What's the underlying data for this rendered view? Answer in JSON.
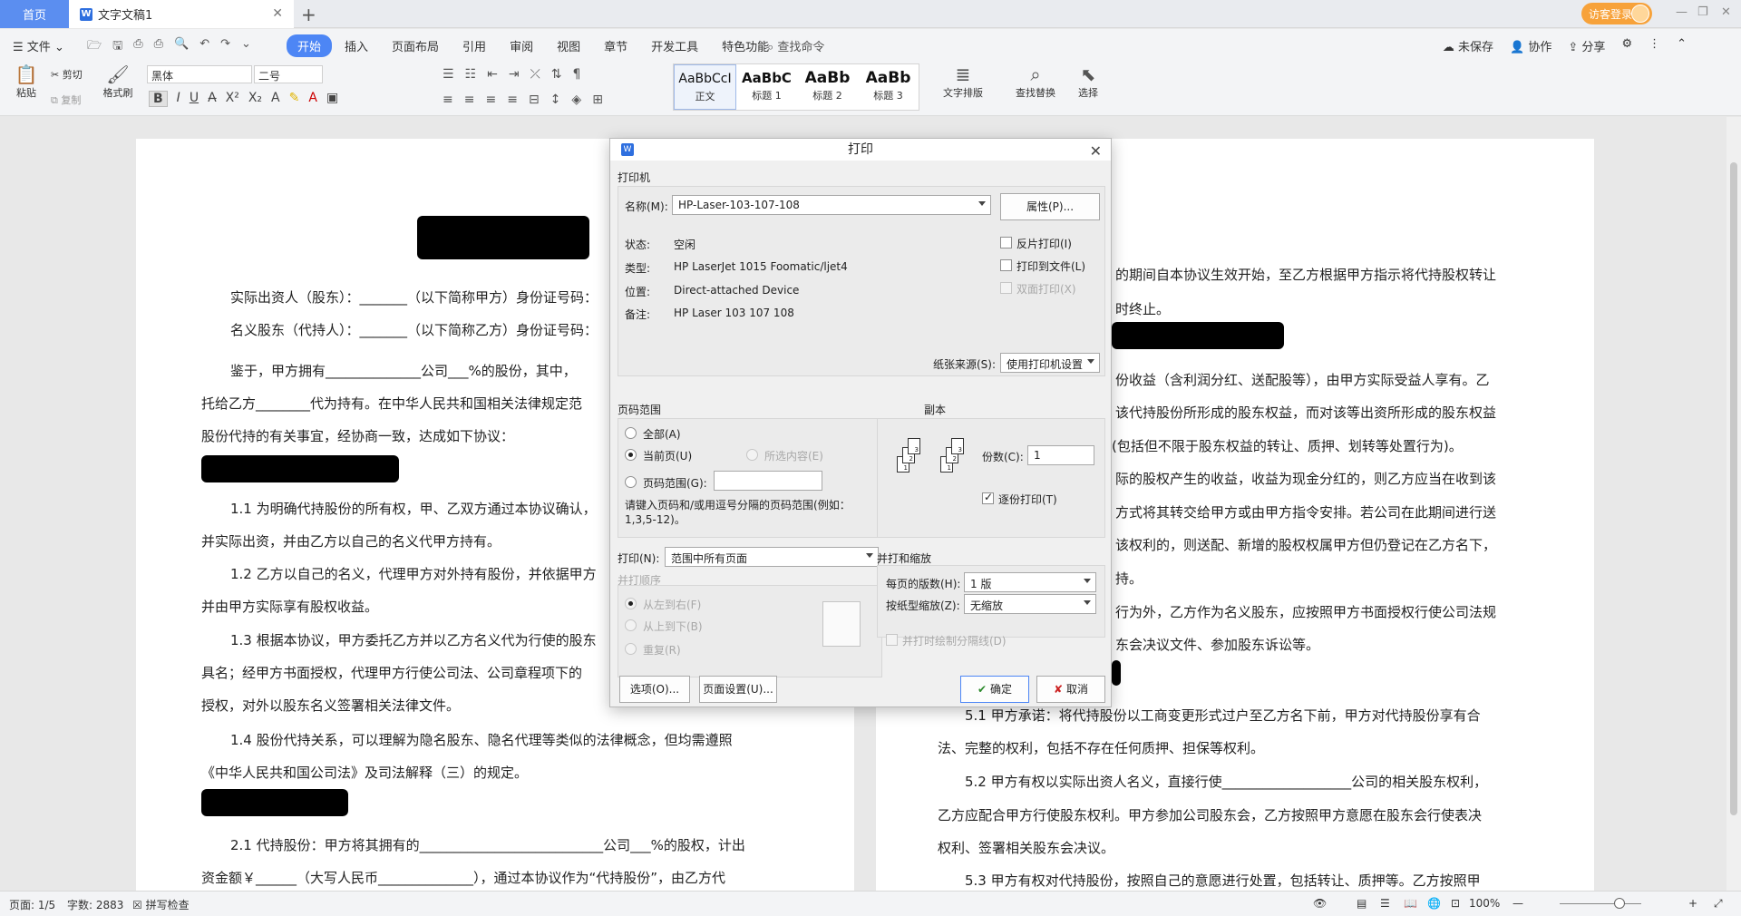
{
  "tabbar": {
    "home": "首页",
    "doc_tab": "文字文稿1",
    "doc_icon": "W",
    "guest": "访客登录"
  },
  "menubar": {
    "file": "文件",
    "items": [
      "开始",
      "插入",
      "页面布局",
      "引用",
      "审阅",
      "视图",
      "章节",
      "开发工具",
      "特色功能"
    ],
    "search": "查找命令",
    "unsaved": "未保存",
    "collab": "协作",
    "share": "分享"
  },
  "ribbon": {
    "paste": "粘贴",
    "cut": "剪切",
    "copy": "复制",
    "format_painter": "格式刷",
    "font": "黑体",
    "size": "二号",
    "styles": [
      {
        "preview": "AaBbCcI",
        "name": "正文"
      },
      {
        "preview": "AaBbC",
        "name": "标题 1"
      },
      {
        "preview": "AaBb",
        "name": "标题 2"
      },
      {
        "preview": "AaBb",
        "name": "标题 3"
      }
    ],
    "text_layout": "文字排版",
    "find_replace": "查找替换",
    "select": "选择"
  },
  "document": {
    "left_lines": [
      "实际出资人（股东）：_______（以下简称甲方）身份证号码：",
      "名义股东（代持人）：_______（以下简称乙方）身份证号码：",
      "鉴于，甲方拥有______________公司___%的股份，其中，",
      "托给乙方________代为持有。在中华人民共和国相关法律规定范",
      "股份代持的有关事宜，经协商一致，达成如下协议：",
      "1.1 为明确代持股份的所有权，甲、乙双方通过本协议确认，",
      "并实际出资，并由乙方以自己的名义代甲方持有。",
      "1.2 乙方以自己的名义，代理甲方对外持有股份，并依据甲方",
      "并由甲方实际享有股权收益。",
      "1.3 根据本协议，甲方委托乙方并以乙方名义代为行使的股东",
      "具名；经甲方书面授权，代理甲方行使公司法、公司章程项下的",
      "授权，对外以股东名义签署相关法律文件。",
      "1.4 股份代持关系，可以理解为隐名股东、隐名代理等类似的法律概念，但均需遵照",
      "《中华人民共和国公司法》及司法解释（三）的规定。",
      "2.1 代持股份：甲方将其拥有的___________________________公司___%的股权，计出",
      "资金额￥______（大写人民币______________），通过本协议作为“代持股份”，由乙方代"
    ],
    "right_lines": [
      "的期间自本协议生效开始，至乙方根据甲方指示将代持股权转让",
      "时终止。",
      "份收益（含利润分红、送配股等），由甲方实际受益人享有。乙",
      "该代持股份所形成的股东权益，而对该等出资所形成的股东权益",
      "(包括但不限于股东权益的转让、质押、划转等处置行为)。",
      "际的股权产生的收益，收益为现金分红的，则乙方应当在收到该",
      "方式将其转交给甲方或由甲方指令安排。若公司在此期间进行送",
      "该权利的，则送配、新增的股权权属甲方但仍登记在乙方名下，",
      "持。",
      "行为外，乙方作为名义股东，应按照甲方书面授权行使公司法规",
      "东会决议文件、参加股东诉讼等。",
      "5.1 甲方承诺：将代持股份以工商变更形式过户至乙方名下前，甲方对代持股份享有合",
      "法、完整的权利，包括不存在任何质押、担保等权利。",
      "5.2 甲方有权以实际出资人名义，直接行使___________________公司的相关股东权利，",
      "乙方应配合甲方行使股东权利。甲方参加公司股东会，乙方按照甲方意愿在股东会行使表决",
      "权利、签署相关股东会决议。",
      "5.3 甲方有权对代持股份，按照自己的意愿进行处置，包括转让、质押等。乙方按照甲"
    ]
  },
  "dialog": {
    "title": "打印",
    "printer_group": "打印机",
    "name_label": "名称(M):",
    "printer_name": "HP-Laser-103-107-108",
    "properties_btn": "属性(P)...",
    "status_label": "状态:",
    "status_value": "空闲",
    "type_label": "类型:",
    "type_value": "HP LaserJet 1015 Foomatic/ljet4",
    "location_label": "位置:",
    "location_value": "Direct-attached Device",
    "comment_label": "备注:",
    "comment_value": "HP Laser 103 107 108",
    "reverse_print": "反片打印(I)",
    "print_to_file": "打印到文件(L)",
    "duplex": "双面打印(X)",
    "paper_source_label": "纸张来源(S):",
    "paper_source": "使用打印机设置",
    "range_group": "页码范围",
    "all": "全部(A)",
    "current_page": "当前页(U)",
    "selection": "所选内容(E)",
    "page_range": "页码范围(G):",
    "range_hint": "请键入页码和/或用逗号分隔的页码范围(例如：1,3,5-12)。",
    "print_label": "打印(N):",
    "print_value": "范围中所有页面",
    "copies_group": "副本",
    "copies_label": "份数(C):",
    "copies_value": "1",
    "collate": "逐份打印(T)",
    "order_group": "并打顺序",
    "left_to_right": "从左到右(F)",
    "top_to_bottom": "从上到下(B)",
    "repeat": "重复(R)",
    "scale_group": "并打和缩放",
    "pages_per_sheet_label": "每页的版数(H):",
    "pages_per_sheet": "1 版",
    "scale_label": "按纸型缩放(Z):",
    "scale_value": "无缩放",
    "draw_borders": "并打时绘制分隔线(D)",
    "options_btn": "选项(O)...",
    "page_setup_btn": "页面设置(U)...",
    "ok_btn": "确定",
    "cancel_btn": "取消"
  },
  "statusbar": {
    "page": "页面: 1/5",
    "words": "字数: 2883",
    "spell": "拼写检查",
    "zoom": "100%"
  }
}
